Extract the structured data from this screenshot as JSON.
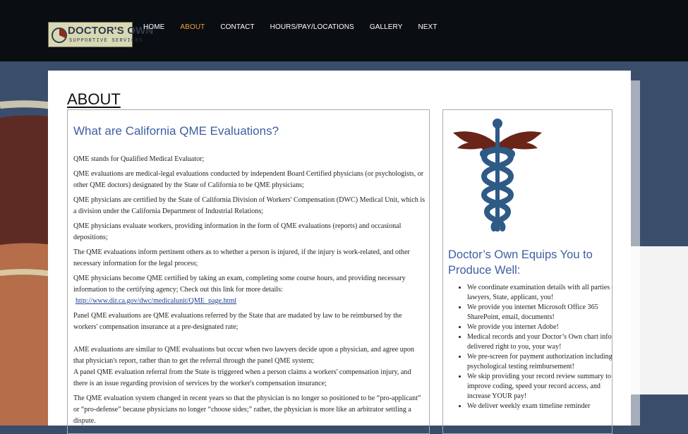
{
  "brand": {
    "name_top": "DOCTOR'S OWN",
    "name_bottom": "SUPPORTIVE SERVICES",
    "colors": {
      "header_bg": "#0a0d12",
      "nav_active": "#f0a23a",
      "heading_blue": "#3f5ea2",
      "logo_bg": "#d8d9b4"
    }
  },
  "nav": {
    "items": [
      {
        "label": "HOME"
      },
      {
        "label": "ABOUT",
        "active": true
      },
      {
        "label": "CONTACT"
      },
      {
        "label": "HOURS/PAY/LOCATIONS"
      },
      {
        "label": "GALLERY"
      },
      {
        "label": "NEXT"
      }
    ]
  },
  "page": {
    "title": "ABOUT",
    "left": {
      "heading": "What are California QME Evaluations?",
      "p1": "QME stands for Qualified Medical Evaluator;",
      "p2": "QME evaluations are medical-legal evaluations conducted by independent Board Certified physicians (or psychologists, or other QME doctors) designated by the State of California to be QME physicians;",
      "p3": "QME physicians are certified by the State of California Division of Workers' Compensation (DWC) Medical Unit, which is a division under the California Department of Industrial Relations;",
      "p4": "QME physicians evaluate workers, providing information in the form of QME evaluations (reports) and occasional depositions;",
      "p5": "The QME evaluations inform pertinent others as to whether a person is injured, if the injury is work-related, and other necessary information for the legal process;",
      "p6": "QME physicians become QME certified by taking an exam, completing some course hours, and providing necessary information to the certifying agency;  Check out this link for more details:",
      "link": "http://www.dir.ca.gov/dwc/medicalunit/QME_page.html",
      "p7": "Panel QME evaluations are QME evaluations referred by the State that are madated by law to be reimbursed by the workers' compensation insurance at a pre-designated rate;",
      "p8": "AME evaluations are similar to QME evaluations but occur when two lawyers decide upon a physician, and agree upon that physician's report, rather than to get the referral through the panel QME system;",
      "p9": "A panel QME evaluation referral from the State is triggered when a person claims a workers' compensation injury, and there is an issue regarding provision of services by the worker's compensation insurance;",
      "p10": "The QME evaluation system changed in recent years so that the physician is no longer so positioned to be “pro-applicant” or “pro-defense” because physicians no longer “choose sides;” rather, the physician is more like an arbitrator settling a dispute."
    },
    "right": {
      "image_icon": "caduceus-icon",
      "heading": "Doctor’s Own Equips You to Produce Well:",
      "bullets": [
        "We coordinate examination details with all parties – lawyers, State, applicant, you!",
        "We provide you internet Microsoft Office 365 SharePoint, email, documents!",
        "We provide you internet Adobe!",
        "Medical records and your Doctor’s Own chart info delivered right to you, your way!",
        "We pre-screen for payment authorization including psychological testing reimbursement!",
        "We skip providing your record review summary to improve coding, speed your record access, and increase YOUR pay!",
        "We deliver weekly exam timeline reminder"
      ]
    }
  }
}
